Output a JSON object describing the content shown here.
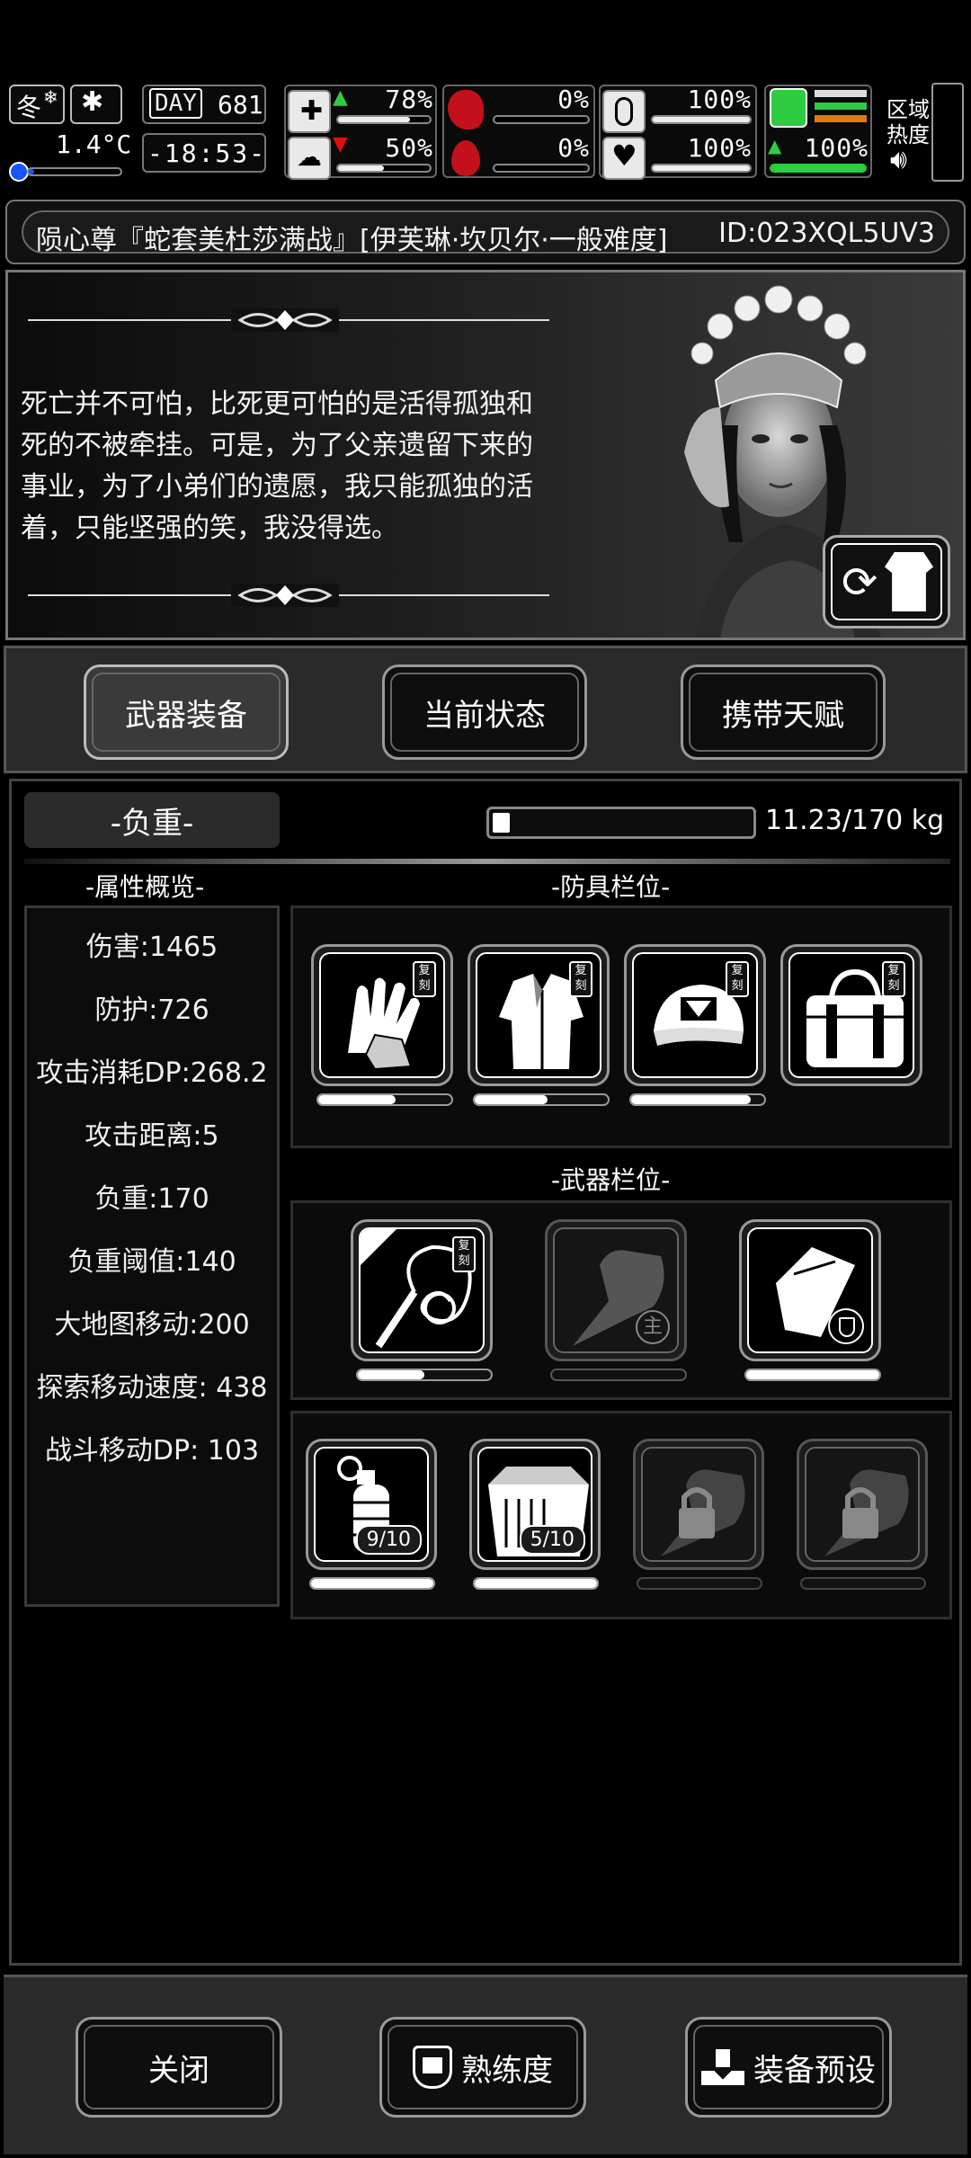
{
  "status": {
    "season": "冬",
    "temperature": "1.4°C",
    "day_label": "DAY",
    "day_value": "681",
    "clock": "-18:53-",
    "health_pct": "78%",
    "brain_pct": "50%",
    "stomach_pct": "0%",
    "blood_pct": "0%",
    "pill_pct": "100%",
    "heart_pct": "100%",
    "stamina_pct": "100%",
    "zone_label_1": "区域",
    "zone_label_2": "热度"
  },
  "title": {
    "text": "陨心尊『蛇套美杜莎满战』[伊芙琳·坎贝尔·一般难度]",
    "id": "ID:023XQL5UV3"
  },
  "story": {
    "text": "死亡并不可怕，比死更可怕的是活得孤独和死的不被牵挂。可是，为了父亲遗留下来的事业，为了小弟们的遗愿，我只能孤独的活着，只能坚强的笑，我没得选。"
  },
  "tabs": {
    "weapons": "武器装备",
    "status": "当前状态",
    "talents": "携带天赋"
  },
  "main": {
    "weight_label": "-负重-",
    "weight_value": "11.23/170 kg",
    "weight_fraction": 0.066,
    "attr_title": "-属性概览-",
    "armor_title": "-防具栏位-",
    "weapon_title": "-武器栏位-",
    "attributes": [
      "伤害:1465",
      "防护:726",
      "攻击消耗DP:268.2",
      "攻击距离:5",
      "负重:170",
      "负重阈值:140",
      "大地图移动:200",
      "探索移动速度: 438",
      "战斗移动DP: 103"
    ],
    "tag_text": "复刻",
    "main_weapon_mark": "主",
    "consumable_counts": [
      "9/10",
      "5/10"
    ]
  },
  "bottom": {
    "close": "关闭",
    "proficiency": "熟练度",
    "preset": "装备预设"
  }
}
